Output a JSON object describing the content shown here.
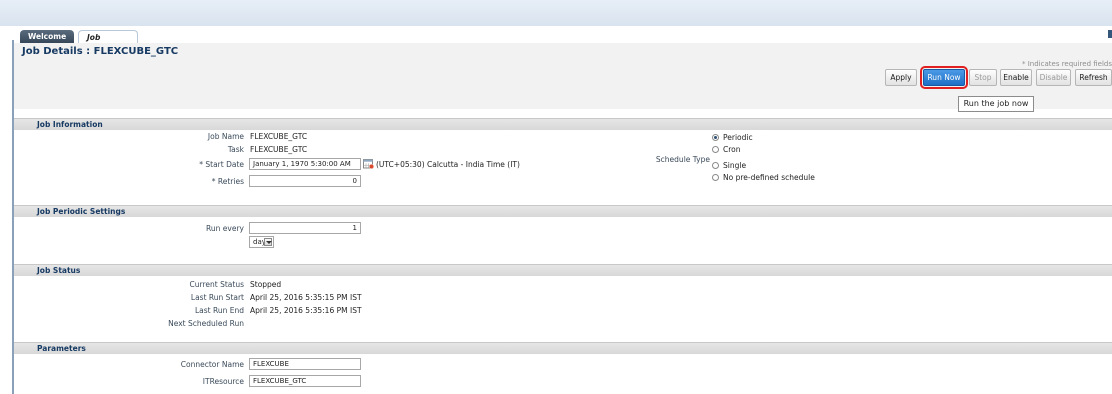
{
  "tabs": {
    "welcome": "Welcome",
    "job_details": "Job Details"
  },
  "page_title": "Job Details : FLEXCUBE_GTC",
  "required_note": "* Indicates required fields",
  "toolbar": {
    "apply": "Apply",
    "run_now": "Run Now",
    "stop": "Stop",
    "enable": "Enable",
    "disable": "Disable",
    "refresh": "Refresh"
  },
  "tooltip": "Run the job now",
  "job_information": {
    "heading": "Job Information",
    "job_name_label": "Job Name",
    "job_name": "FLEXCUBE_GTC",
    "task_label": "Task",
    "task": "FLEXCUBE_GTC",
    "start_date_label": "* Start Date",
    "start_date": "January 1, 1970 5:30:00 AM",
    "timezone": "(UTC+05:30) Calcutta - India Time (IT)",
    "retries_label": "* Retries",
    "retries": "0",
    "schedule_type_label": "Schedule Type",
    "schedule_options": [
      "Periodic",
      "Cron",
      "Single",
      "No pre-defined schedule"
    ],
    "schedule_selected": "Periodic"
  },
  "job_periodic": {
    "heading": "Job Periodic Settings",
    "run_every_label": "Run every",
    "run_every": "1",
    "unit": "days"
  },
  "job_status": {
    "heading": "Job Status",
    "current_status_label": "Current Status",
    "current_status": "Stopped",
    "last_run_start_label": "Last Run Start",
    "last_run_start": "April 25, 2016 5:35:15 PM IST",
    "last_run_end_label": "Last Run End",
    "last_run_end": "April 25, 2016 5:35:16 PM IST",
    "next_run_label": "Next Scheduled Run",
    "next_run": ""
  },
  "parameters": {
    "heading": "Parameters",
    "connector_name_label": "Connector Name",
    "connector_name": "FLEXCUBE",
    "itresource_label": "ITResource",
    "itresource": "FLEXCUBE_GTC"
  },
  "icons": {
    "calendar": "calendar-icon",
    "dropdown": "chevron-down-icon"
  }
}
